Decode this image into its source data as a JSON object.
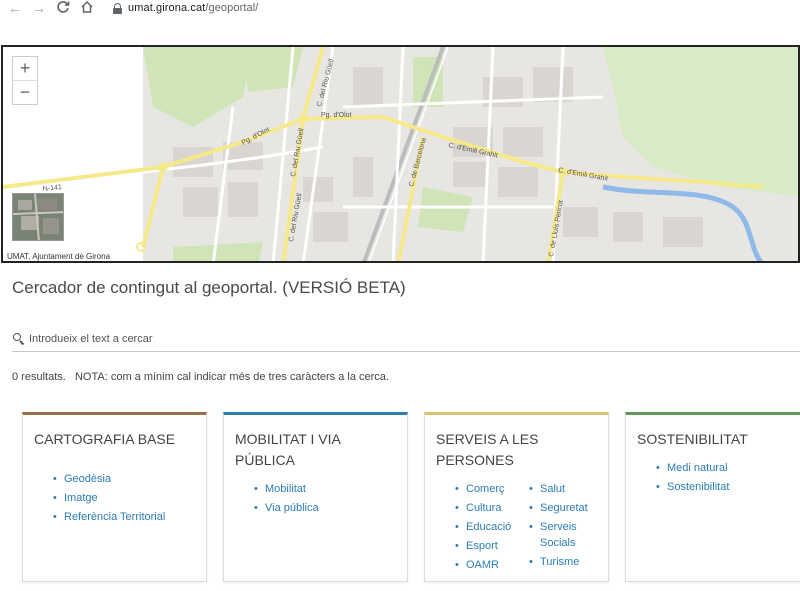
{
  "browser": {
    "url_host": "umat.girona.cat",
    "url_path": "/geoportal/",
    "back_icon": "arrow-left-icon",
    "forward_icon": "arrow-right-icon",
    "reload_icon": "reload-icon",
    "home_icon": "home-icon"
  },
  "map": {
    "zoom_in": "+",
    "zoom_out": "−",
    "attribution": "UMAT, Ajuntament de Girona",
    "street_labels": [
      "Pg. d'Olot",
      "Pg. d'Olot",
      "C. del Riu Güell",
      "C. del Riu Güell",
      "C. del Riu Güell",
      "C. de Barcelona",
      "C. d'Emili Grahit",
      "C. d'Emili Grahit",
      "C. de Lluís Pericot",
      "N-141"
    ]
  },
  "page": {
    "title": "Cercador de contingut al geoportal. (VERSIÓ BETA)",
    "search_placeholder": "Introdueix el text a cercar",
    "results_text": "0 resultats.   NOTA: com a mínim cal indicar més de tres caràcters a la cerca."
  },
  "cards": [
    {
      "title": "CARTOGRAFIA BASE",
      "color": "#9b6f4a",
      "col1": [
        "Geodèsia",
        "Imatge",
        "Referència Territorial"
      ],
      "col2": []
    },
    {
      "title": "MOBILITAT I VIA PÚBLICA",
      "color": "#2b7fb0",
      "col1": [
        "Mobilitat",
        "Via pública"
      ],
      "col2": []
    },
    {
      "title": "SERVEIS A LES PERSONES",
      "color": "#d8c46a",
      "col1": [
        "Comerç",
        "Cultura",
        "Educació",
        "Esport",
        "OAMR"
      ],
      "col2": [
        "Salut",
        "Seguretat",
        "Serveis Socials",
        "Turisme"
      ]
    },
    {
      "title": "SOSTENIBILITAT",
      "color": "#5f9a5a",
      "col1": [
        "Medi natural",
        "Sostenibilitat"
      ],
      "col2": []
    }
  ]
}
